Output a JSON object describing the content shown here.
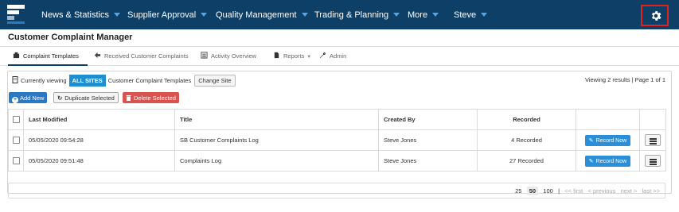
{
  "nav": {
    "items": [
      {
        "label": "News & Statistics"
      },
      {
        "label": "Supplier Approval"
      },
      {
        "label": "Quality Management"
      },
      {
        "label": "Trading & Planning"
      },
      {
        "label": "More"
      },
      {
        "label": "Steve"
      }
    ],
    "settings_icon": "gear-icon"
  },
  "page": {
    "title": "Customer Complaint Manager"
  },
  "tabs": [
    {
      "label": "Complaint Templates",
      "icon": "clipboard-icon"
    },
    {
      "label": "Received Customer Complaints",
      "icon": "arrow-left-icon"
    },
    {
      "label": "Activity Overview",
      "icon": "list-icon"
    },
    {
      "label": "Reports",
      "icon": "file-icon"
    },
    {
      "label": "Admin",
      "icon": "wrench-icon"
    }
  ],
  "viewing": {
    "prefix": "Currently viewing",
    "scope": "ALL SITES",
    "suffix": "Customer Complaint Templates",
    "change_site": "Change Site",
    "results": "Viewing 2 results | Page 1 of 1"
  },
  "actions": {
    "add": "Add New",
    "duplicate": "Duplicate Selected",
    "delete": "Delete Selected"
  },
  "table": {
    "headers": [
      "Last Modified",
      "Title",
      "Created By",
      "Recorded"
    ],
    "rows": [
      {
        "last_modified": "05/05/2020 09:54:28",
        "title": "SB Customer Complaints Log",
        "created_by": "Steve Jones",
        "recorded": "4 Recorded",
        "action": "Record Now"
      },
      {
        "last_modified": "05/05/2020 09:51:48",
        "title": "Complaints Log",
        "created_by": "Steve Jones",
        "recorded": "27 Recorded",
        "action": "Record Now"
      }
    ]
  },
  "pagination": {
    "sizes": [
      "25",
      "50",
      "100"
    ],
    "current_size": "50",
    "separator": "|",
    "first": "<< first",
    "previous": "< previous",
    "next": "next >",
    "last": "last >>"
  },
  "colors": {
    "nav_bg": "#0e3f66",
    "accent": "#1f8fd0",
    "delete": "#d9534f",
    "highlight_border": "#e32121"
  }
}
